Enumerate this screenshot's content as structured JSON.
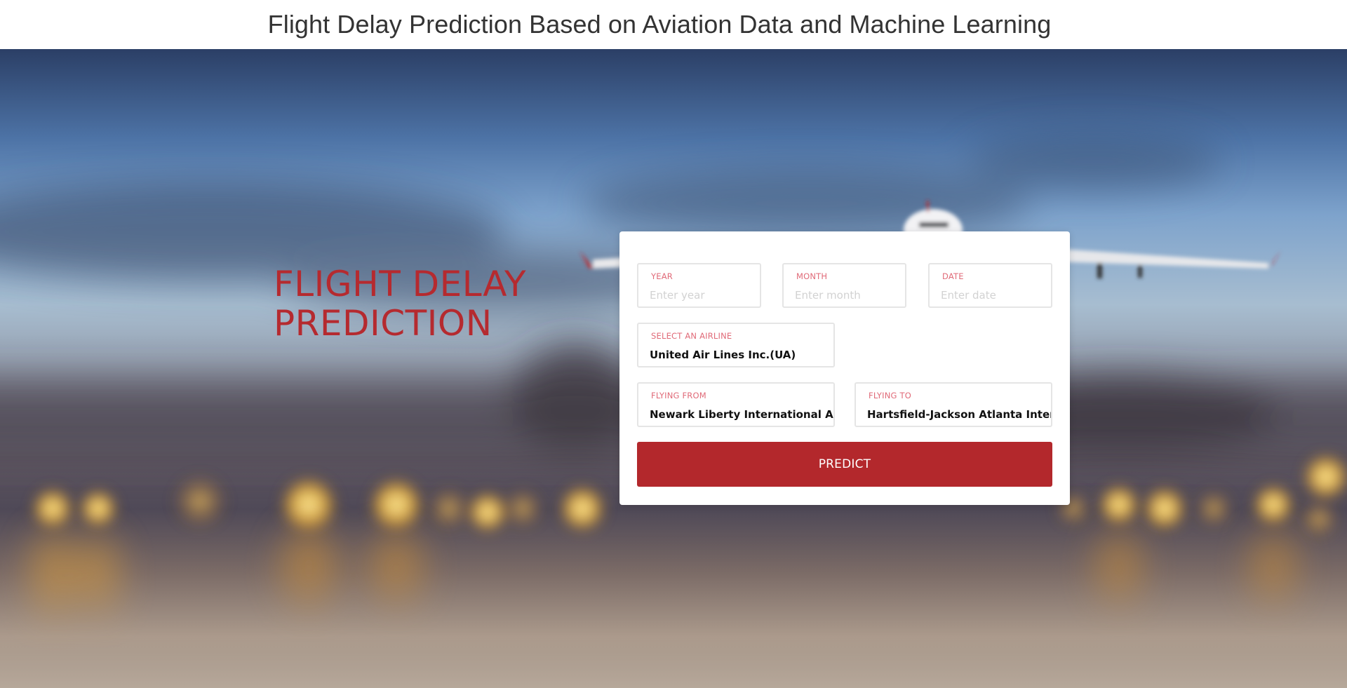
{
  "header": {
    "title": "Flight Delay Prediction Based on Aviation Data and Machine Learning"
  },
  "hero": {
    "title_line1": "FLIGHT DELAY",
    "title_line2": "PREDICTION",
    "background": "blurred-airport-night-with-airplane"
  },
  "form": {
    "year": {
      "label": "YEAR",
      "placeholder": "Enter year",
      "value": ""
    },
    "month": {
      "label": "MONTH",
      "placeholder": "Enter month",
      "value": ""
    },
    "date": {
      "label": "DATE",
      "placeholder": "Enter date",
      "value": ""
    },
    "airline": {
      "label": "SELECT AN AIRLINE",
      "value": "United Air Lines Inc.(UA)"
    },
    "flying_from": {
      "label": "FLYING FROM",
      "value": "Newark Liberty International Airpo"
    },
    "flying_to": {
      "label": "FLYING TO",
      "value": "Hartsfield-Jackson Atlanta Interna"
    },
    "predict_label": "PREDICT"
  },
  "colors": {
    "accent": "#b3282c",
    "label": "#e06a78",
    "hero_title": "#b52a2f"
  }
}
